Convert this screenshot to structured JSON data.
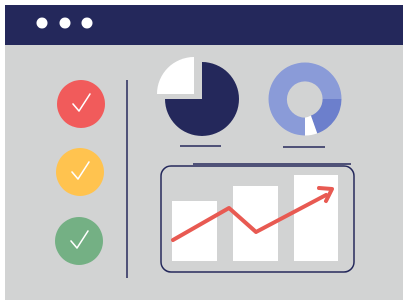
{
  "window": {
    "dot_count": 3,
    "colors": {
      "frame": "#24285b",
      "body": "#d2d3d3",
      "dot": "#ffffff"
    }
  },
  "checklist": {
    "items": [
      {
        "status": "checked",
        "color": "#f15b5b",
        "icon": "checkmark-icon"
      },
      {
        "status": "checked",
        "color": "#ffc34f",
        "icon": "checkmark-icon"
      },
      {
        "status": "checked",
        "color": "#74b084",
        "icon": "checkmark-icon"
      }
    ],
    "divider_color": "#24285b"
  },
  "pie_chart": {
    "fill_color": "#24285b",
    "cutout_color": "#ffffff"
  },
  "donut_chart": {
    "colors": [
      "#6c7fcc",
      "#8a9bd8",
      "#ffffff"
    ]
  },
  "trend_chart": {
    "bar_color": "#ffffff",
    "frame_color": "#24285b",
    "line_color": "#e85a52"
  }
}
